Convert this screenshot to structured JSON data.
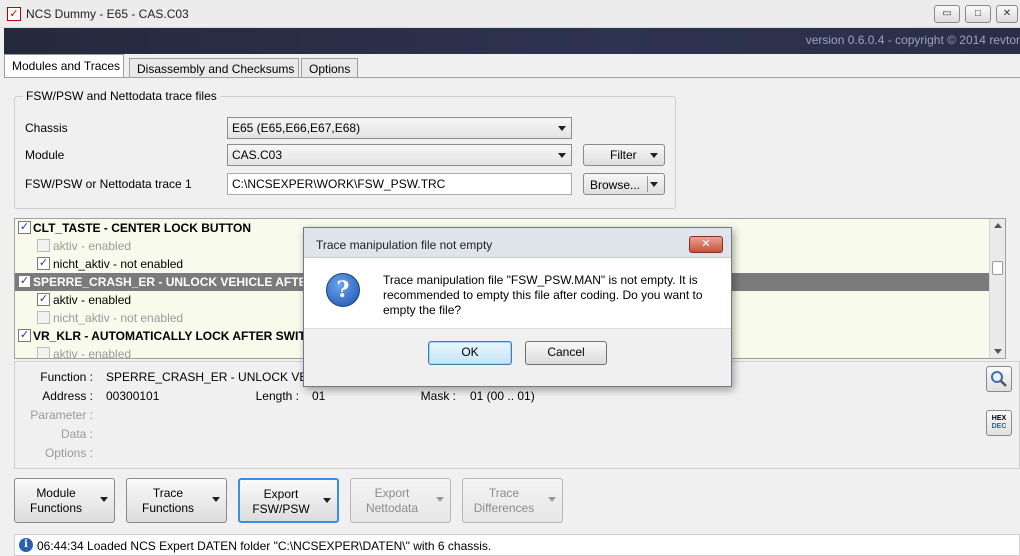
{
  "window": {
    "title": "NCS Dummy - E65 - CAS.C03",
    "app_icon": "checkbox-logo-icon",
    "minimize": "▭",
    "maximize": "□",
    "close": "✕"
  },
  "banner": {
    "version_text": "version 0.6.0.4 - copyright © 2014 revtor"
  },
  "tabs": [
    {
      "label": "Modules and Traces",
      "active": true
    },
    {
      "label": "Disassembly and Checksums",
      "active": false
    },
    {
      "label": "Options",
      "active": false
    }
  ],
  "trace_files": {
    "legend": "FSW/PSW and Nettodata trace files",
    "chassis_label": "Chassis",
    "chassis_value": "E65  (E65,E66,E67,E68)",
    "module_label": "Module",
    "module_value": "CAS.C03",
    "filter_button": "Filter",
    "trace_label": "FSW/PSW or Nettodata trace 1",
    "trace_value": "C:\\NCSEXPER\\WORK\\FSW_PSW.TRC",
    "browse_button": "Browse..."
  },
  "tree": {
    "rows": [
      {
        "text": "CLT_TASTE  -  CENTER LOCK BUTTON",
        "checked": true,
        "level": 0
      },
      {
        "text": "aktiv  -  enabled",
        "checked": false,
        "level": 1
      },
      {
        "text": "nicht_aktiv  -  not enabled",
        "checked": true,
        "level": 1
      },
      {
        "text": "SPERRE_CRASH_ER  -  UNLOCK VEHICLE AFTER CRASH",
        "checked": true,
        "level": 0,
        "selected": true
      },
      {
        "text": "aktiv  -  enabled",
        "checked": true,
        "level": 1
      },
      {
        "text": "nicht_aktiv  -  not enabled",
        "checked": false,
        "level": 1
      },
      {
        "text": "VR_KLR  -  AUTOMATICALLY LOCK AFTER SWITCHING OFF IGNITION",
        "checked": true,
        "level": 0
      },
      {
        "text": "aktiv  -  enabled",
        "checked": false,
        "level": 1
      }
    ]
  },
  "details": {
    "function_label": "Function :",
    "function_value": "SPERRE_CRASH_ER  -  UNLOCK VEHICLE AFTER CRASH",
    "address_label": "Address :",
    "address_value": "00300101",
    "length_label": "Length :",
    "length_value": "01",
    "mask_label": "Mask :",
    "mask_value": "01  (00 .. 01)",
    "parameter_label": "Parameter :",
    "data_label": "Data :",
    "options_label": "Options :",
    "hex_label_1": "HEX",
    "hex_label_2": "DEC"
  },
  "function_buttons": [
    {
      "line1": "Module",
      "line2": "Functions",
      "enabled": true,
      "focused": false
    },
    {
      "line1": "Trace",
      "line2": "Functions",
      "enabled": true,
      "focused": false
    },
    {
      "line1": "Export",
      "line2": "FSW/PSW",
      "enabled": true,
      "focused": true
    },
    {
      "line1": "Export",
      "line2": "Nettodata",
      "enabled": false,
      "focused": false
    },
    {
      "line1": "Trace",
      "line2": "Differences",
      "enabled": false,
      "focused": false
    }
  ],
  "status": {
    "message": "06:44:34  Loaded NCS Expert DATEN folder \"C:\\NCSEXPER\\DATEN\\\" with 6 chassis."
  },
  "dialog": {
    "title": "Trace manipulation file not empty",
    "close": "✕",
    "icon": "question-icon",
    "icon_glyph": "?",
    "message": "Trace manipulation file \"FSW_PSW.MAN\" is not empty. It is recommended to empty this file after coding. Do you want to empty the file?",
    "ok_button": "OK",
    "cancel_button": "Cancel"
  }
}
